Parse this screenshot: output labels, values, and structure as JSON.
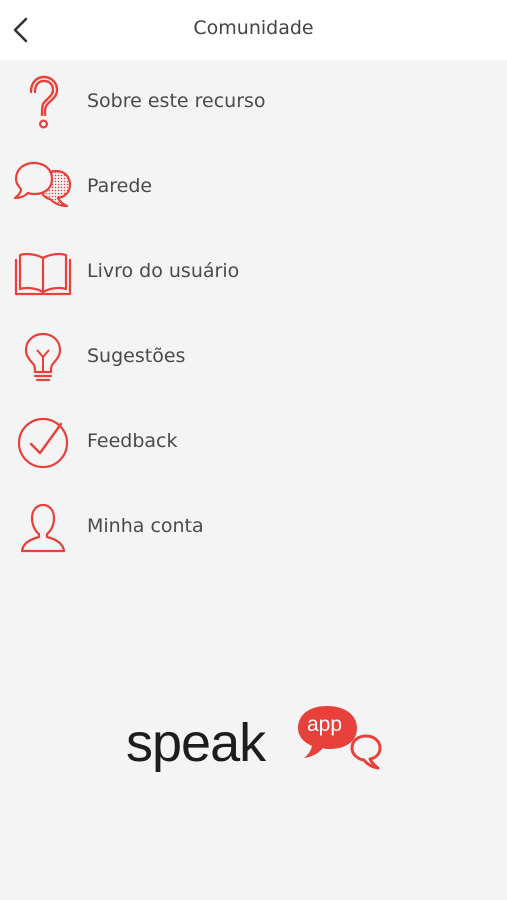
{
  "header": {
    "title": "Comunidade",
    "back_icon": "chevron-left-icon"
  },
  "menu": [
    {
      "label": "Sobre este recurso",
      "icon": "question-icon"
    },
    {
      "label": "Parede",
      "icon": "chat-bubbles-icon"
    },
    {
      "label": "Livro do usuário",
      "icon": "book-icon"
    },
    {
      "label": "Sugestões",
      "icon": "lightbulb-icon"
    },
    {
      "label": "Feedback",
      "icon": "checkmark-circle-icon"
    },
    {
      "label": "Minha conta",
      "icon": "user-icon"
    }
  ],
  "logo": {
    "word": "speak",
    "badge": "app"
  },
  "colors": {
    "accent": "#e8403a",
    "text": "#4a4a4a",
    "background": "#f4f4f4"
  }
}
